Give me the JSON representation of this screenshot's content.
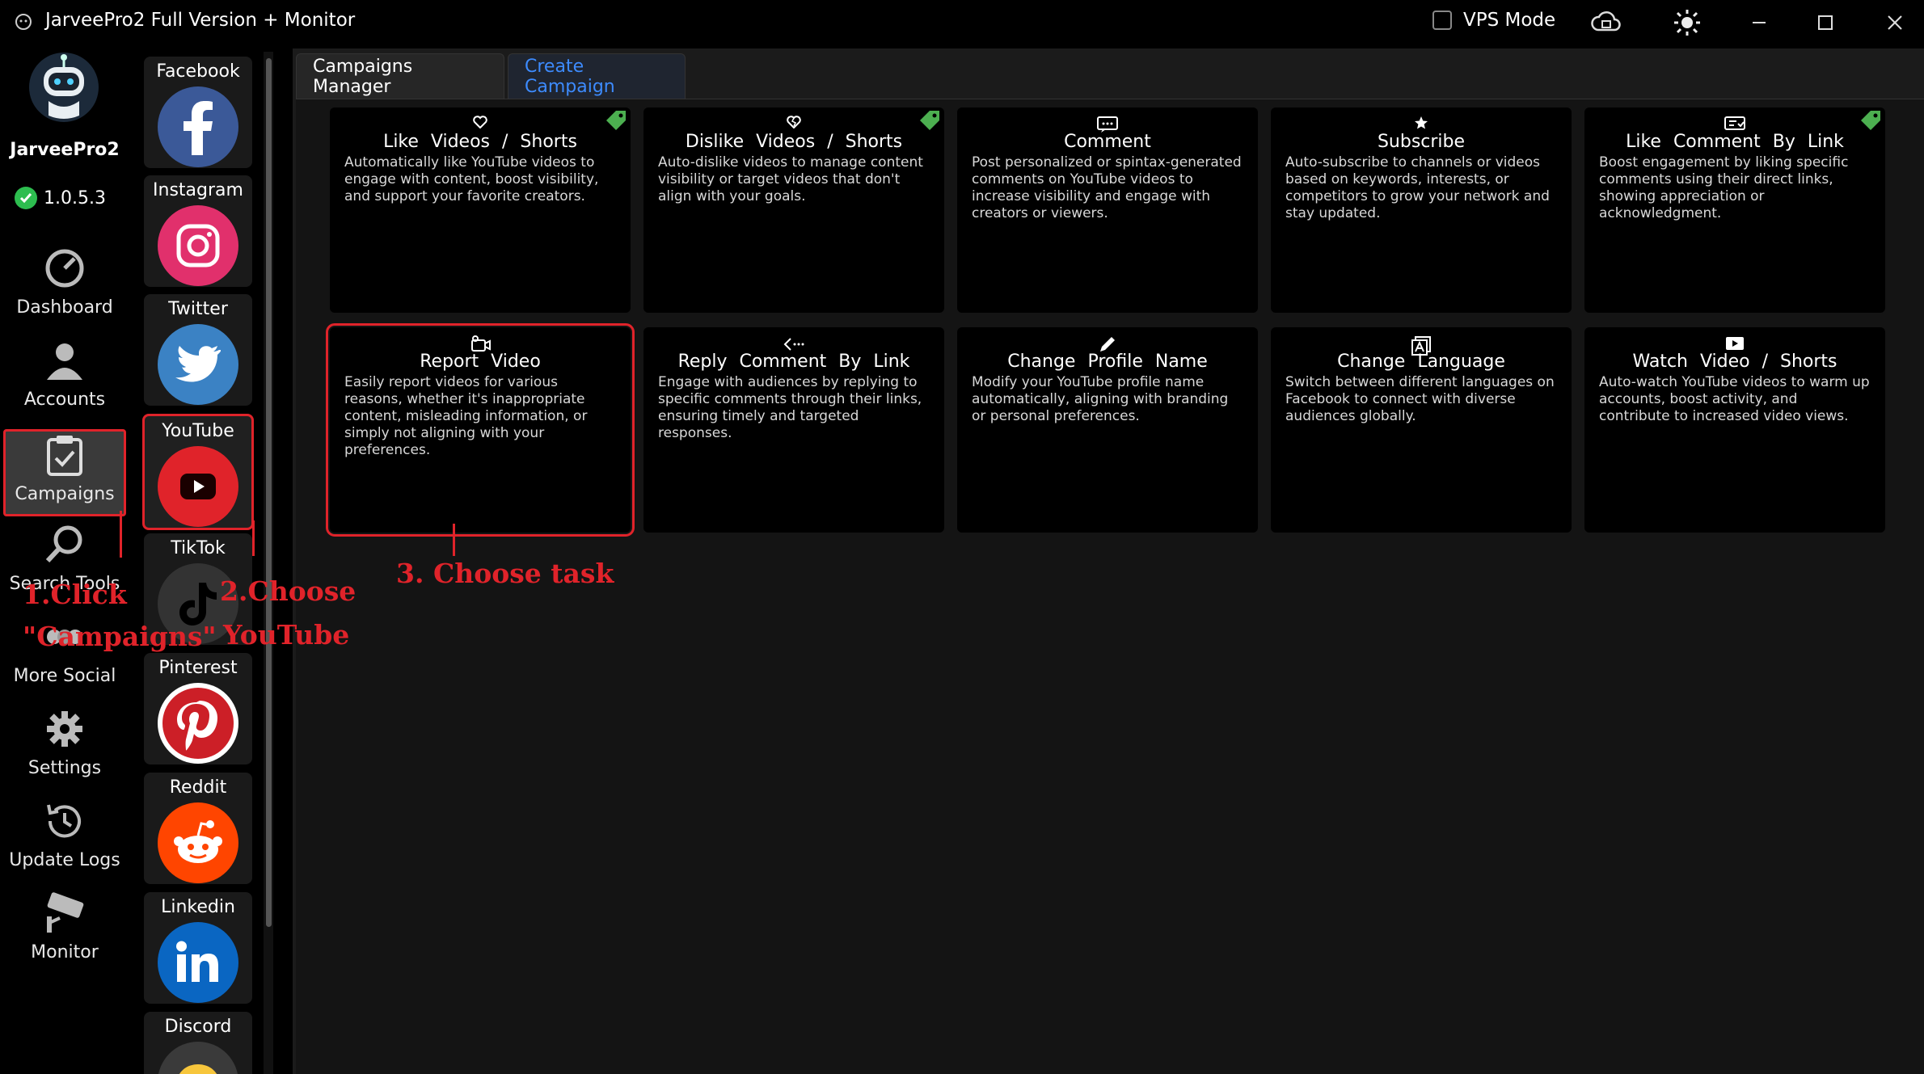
{
  "window": {
    "title": "JarveePro2 Full Version + Monitor",
    "vps_label": "VPS Mode"
  },
  "brand": {
    "name": "JarveePro2",
    "version": "1.0.5.3"
  },
  "nav": [
    {
      "label": "Dashboard",
      "icon": "dashboard-icon"
    },
    {
      "label": "Accounts",
      "icon": "accounts-icon"
    },
    {
      "label": "Campaigns",
      "icon": "clipboard-check-icon",
      "active": true
    },
    {
      "label": "Search Tools",
      "icon": "search-icon"
    },
    {
      "label": "More Social",
      "icon": "more-social-icon"
    },
    {
      "label": "Settings",
      "icon": "gear-icon"
    },
    {
      "label": "Update Logs",
      "icon": "history-icon"
    },
    {
      "label": "Monitor",
      "icon": "camera-icon"
    }
  ],
  "socials": [
    {
      "label": "Facebook",
      "color": "#3b5998"
    },
    {
      "label": "Instagram",
      "color": "#e1306c"
    },
    {
      "label": "Twitter",
      "color": "#3b82c4"
    },
    {
      "label": "YouTube",
      "color": "#e0232a",
      "selected": true
    },
    {
      "label": "TikTok",
      "color": "#333333"
    },
    {
      "label": "Pinterest",
      "color": "#cc1f27"
    },
    {
      "label": "Reddit",
      "color": "#ff4500"
    },
    {
      "label": "Linkedin",
      "color": "#0a66c2"
    },
    {
      "label": "Discord",
      "color": "#5865f2"
    }
  ],
  "tabs": [
    {
      "label": "Campaigns Manager"
    },
    {
      "label": "Create Campaign",
      "active": true
    }
  ],
  "cards": [
    {
      "title": "Like Videos / Shorts",
      "desc": "Automatically like YouTube videos to engage with content, boost visibility, and support your favorite creators.",
      "icon": "heart-icon",
      "tag": true
    },
    {
      "title": "Dislike Videos / Shorts",
      "desc": "Auto-dislike videos to manage content visibility or target videos that don't align with your goals.",
      "icon": "broken-heart-icon",
      "tag": true
    },
    {
      "title": "Comment",
      "desc": "Post personalized or spintax-generated comments on YouTube videos to increase visibility and engage with creators or viewers.",
      "icon": "comment-icon",
      "tag": false
    },
    {
      "title": "Subscribe",
      "desc": "Auto-subscribe to channels or videos based on keywords, interests, or competitors to grow your network and stay updated.",
      "icon": "star-icon",
      "tag": false
    },
    {
      "title": "Like Comment By Link",
      "desc": "Boost engagement by liking specific comments using their direct links, showing appreciation or acknowledgment.",
      "icon": "like-comment-icon",
      "tag": true
    },
    {
      "title": "Report Video",
      "desc": "Easily report videos for various reasons, whether it's inappropriate content, misleading information, or simply not aligning with your preferences.",
      "icon": "report-video-icon",
      "tag": false,
      "highlight": true
    },
    {
      "title": "Reply Comment By Link",
      "desc": "Engage with audiences by replying to specific comments through their links, ensuring timely and targeted responses.",
      "icon": "reply-icon",
      "tag": false
    },
    {
      "title": "Change Profile Name",
      "desc": "Modify your YouTube profile name automatically, aligning with branding or personal preferences.",
      "icon": "pencil-icon",
      "tag": false
    },
    {
      "title": "Change Language",
      "desc": "Switch between different languages on Facebook to connect with diverse audiences globally.",
      "icon": "language-icon",
      "tag": false
    },
    {
      "title": "Watch Video / Shorts",
      "desc": "Auto-watch YouTube videos to warm up accounts, boost activity, and contribute to increased video views.",
      "icon": "play-icon",
      "tag": false
    }
  ],
  "annotations": {
    "step1_a": "1.Click",
    "step1_b": "\"Campaigns\"",
    "step2_a": "2.Choose",
    "step2_b": "YouTube",
    "step3": "3. Choose task"
  },
  "colors": {
    "accent": "#3d8bfd",
    "annotation": "#e0232a",
    "tag": "#4caf50"
  }
}
